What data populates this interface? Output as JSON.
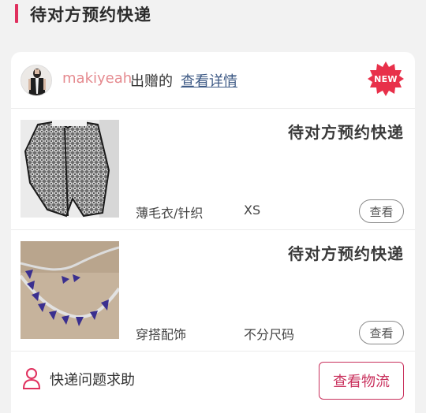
{
  "section": {
    "title": "待对方预约快递"
  },
  "card": {
    "username": "makiyeah",
    "donated_label": "出赠的",
    "detail_link": "查看详情",
    "new_badge": "NEW",
    "items": [
      {
        "image": "knit-cardigan-photo",
        "status": "待对方预约快递",
        "category": "薄毛衣/针织",
        "size": "XS",
        "view_label": "查看"
      },
      {
        "image": "triangle-necklace-photo",
        "status": "待对方预约快递",
        "category": "穿搭配饰",
        "size": "不分尺码",
        "view_label": "查看"
      }
    ],
    "footer": {
      "help_text": "快递问题求助",
      "logistics_button": "查看物流"
    }
  },
  "colors": {
    "accent": "#e0305e",
    "username": "#e58a8f",
    "link": "#3f5b86",
    "badge": "#e8304a",
    "button_border": "#c9315d"
  }
}
